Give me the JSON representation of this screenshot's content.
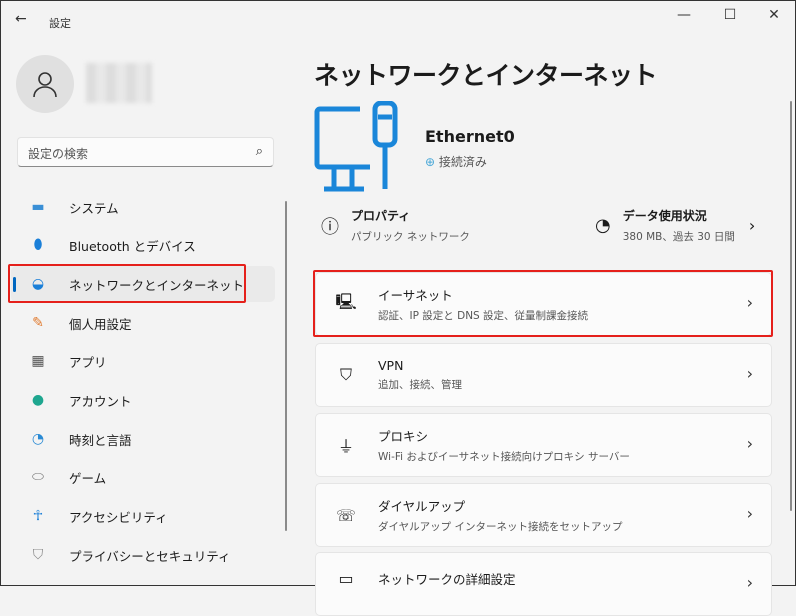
{
  "window": {
    "title": "設定",
    "back": "←",
    "minimize": "—",
    "maximize": "☐",
    "close": "✕"
  },
  "search": {
    "placeholder": "設定の検索",
    "icon": "⌕"
  },
  "sidebar": {
    "items": [
      {
        "label": "システム",
        "icon": "system-icon"
      },
      {
        "label": "Bluetooth とデバイス",
        "icon": "bluetooth-icon"
      },
      {
        "label": "ネットワークとインターネット",
        "icon": "wifi-icon",
        "selected": true
      },
      {
        "label": "個人用設定",
        "icon": "brush-icon"
      },
      {
        "label": "アプリ",
        "icon": "apps-icon"
      },
      {
        "label": "アカウント",
        "icon": "account-icon"
      },
      {
        "label": "時刻と言語",
        "icon": "clock-globe-icon"
      },
      {
        "label": "ゲーム",
        "icon": "gamepad-icon"
      },
      {
        "label": "アクセシビリティ",
        "icon": "accessibility-icon"
      },
      {
        "label": "プライバシーとセキュリティ",
        "icon": "shield-icon"
      }
    ]
  },
  "main": {
    "title": "ネットワークとインターネット",
    "ethernet": {
      "name": "Ethernet0",
      "status": "接続済み"
    },
    "properties": {
      "title": "プロパティ",
      "subtitle": "パブリック ネットワーク"
    },
    "data_usage": {
      "title": "データ使用状況",
      "subtitle": "380 MB、過去 30 日間"
    },
    "cards": [
      {
        "title": "イーサネット",
        "subtitle": "認証、IP 設定と DNS 設定、従量制課金接続"
      },
      {
        "title": "VPN",
        "subtitle": "追加、接続、管理"
      },
      {
        "title": "プロキシ",
        "subtitle": "Wi-Fi およびイーサネット接続向けプロキシ サーバー"
      },
      {
        "title": "ダイヤルアップ",
        "subtitle": "ダイヤルアップ インターネット接続をセットアップ"
      },
      {
        "title": "ネットワークの詳細設定",
        "subtitle": ""
      }
    ]
  },
  "colors": {
    "accent": "#0067c0",
    "highlight": "#e5201b"
  }
}
